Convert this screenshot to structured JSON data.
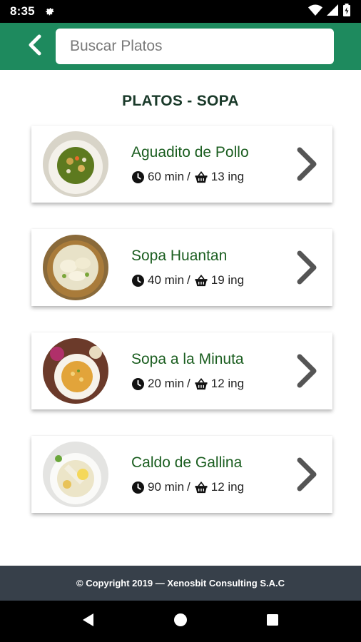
{
  "status_bar": {
    "time": "8:35",
    "icons": [
      "gear-icon",
      "wifi-icon",
      "signal-icon",
      "battery-icon"
    ]
  },
  "app_bar": {
    "back_icon": "chevron-left-icon",
    "search_placeholder": "Buscar Platos",
    "search_value": ""
  },
  "section_title": "PLATOS - SOPA",
  "dishes": [
    {
      "name": "Aguadito de Pollo",
      "time": "60 min",
      "ingredients": "13 ing"
    },
    {
      "name": "Sopa Huantan",
      "time": "40 min",
      "ingredients": "19 ing"
    },
    {
      "name": "Sopa a la Minuta",
      "time": "20 min",
      "ingredients": "12 ing"
    },
    {
      "name": "Caldo de Gallina",
      "time": "90 min",
      "ingredients": "12 ing"
    }
  ],
  "meta_separator": "/",
  "footer": {
    "copyright": "© Copyright 2019 — Xenosbit Consulting S.A.C"
  },
  "nav": {
    "back": "back-triangle-icon",
    "home": "home-circle-icon",
    "recents": "recents-square-icon"
  },
  "colors": {
    "app_bar": "#1e8a5e",
    "title_green": "#1b5e20",
    "footer": "#37404a",
    "chevron": "#555555"
  }
}
